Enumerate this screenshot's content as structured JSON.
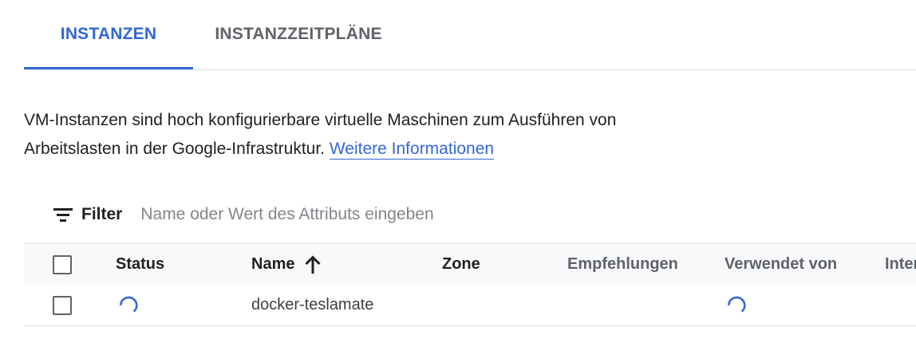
{
  "tabs": [
    {
      "label": "INSTANZEN",
      "active": true
    },
    {
      "label": "INSTANZZEITPLÄNE",
      "active": false
    }
  ],
  "description": {
    "line1": "VM-Instanzen sind hoch konfigurierbare virtuelle Maschinen zum Ausführen von",
    "line2": "Arbeitslasten in der Google-Infrastruktur.",
    "link_text": "Weitere Informationen"
  },
  "filter": {
    "icon": "filter-list-icon",
    "label": "Filter",
    "placeholder": "Name oder Wert des Attributs eingeben"
  },
  "table": {
    "columns": [
      {
        "key": "status",
        "label": "Status"
      },
      {
        "key": "name",
        "label": "Name",
        "sort": "ascending",
        "sort_icon": "arrow-upward-icon"
      },
      {
        "key": "zone",
        "label": "Zone"
      },
      {
        "key": "recommendations",
        "label": "Empfehlungen"
      },
      {
        "key": "used_by",
        "label": "Verwendet von"
      },
      {
        "key": "internal",
        "label": "Inter"
      }
    ],
    "rows": [
      {
        "status": "loading",
        "name": "docker-teslamate",
        "zone": "",
        "recommendations": "",
        "used_by": "loading",
        "internal": ""
      }
    ]
  },
  "colors": {
    "accent": "#3367d6",
    "text": "#202124",
    "muted": "#5f6368",
    "border": "#dadce0",
    "header_bg": "#f8f9fa"
  }
}
